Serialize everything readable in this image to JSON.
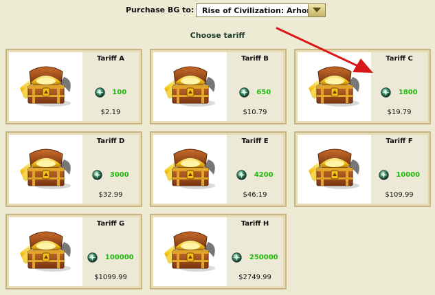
{
  "purchase": {
    "label": "Purchase BG to:",
    "selected_server": "Rise of Civilization: Arhon"
  },
  "choose_title": "Choose tariff",
  "tariffs": [
    {
      "name": "Tariff A",
      "amount": "100",
      "price": "$2.19"
    },
    {
      "name": "Tariff  B",
      "amount": "650",
      "price": "$10.79"
    },
    {
      "name": "Tariff  C",
      "amount": "1800",
      "price": "$19.79"
    },
    {
      "name": "Tariff  D",
      "amount": "3000",
      "price": "$32.99"
    },
    {
      "name": "Tariff  E",
      "amount": "4200",
      "price": "$46.19"
    },
    {
      "name": "Tariff  F",
      "amount": "10000",
      "price": "$109.99"
    },
    {
      "name": "Tariff G",
      "amount": "100000",
      "price": "$1099.99"
    },
    {
      "name": "Tariff H",
      "amount": "250000",
      "price": "$2749.99"
    }
  ],
  "icons": {
    "chest": "treasure-chest-icon",
    "currency": "bg-gem-icon",
    "dropdown": "chevron-down-icon",
    "annotation": "red-arrow-annotation"
  },
  "colors": {
    "background": "#eeebd4",
    "card_border": "#c6b483",
    "amount_green": "#21b80c",
    "arrow_red": "#d81818"
  }
}
